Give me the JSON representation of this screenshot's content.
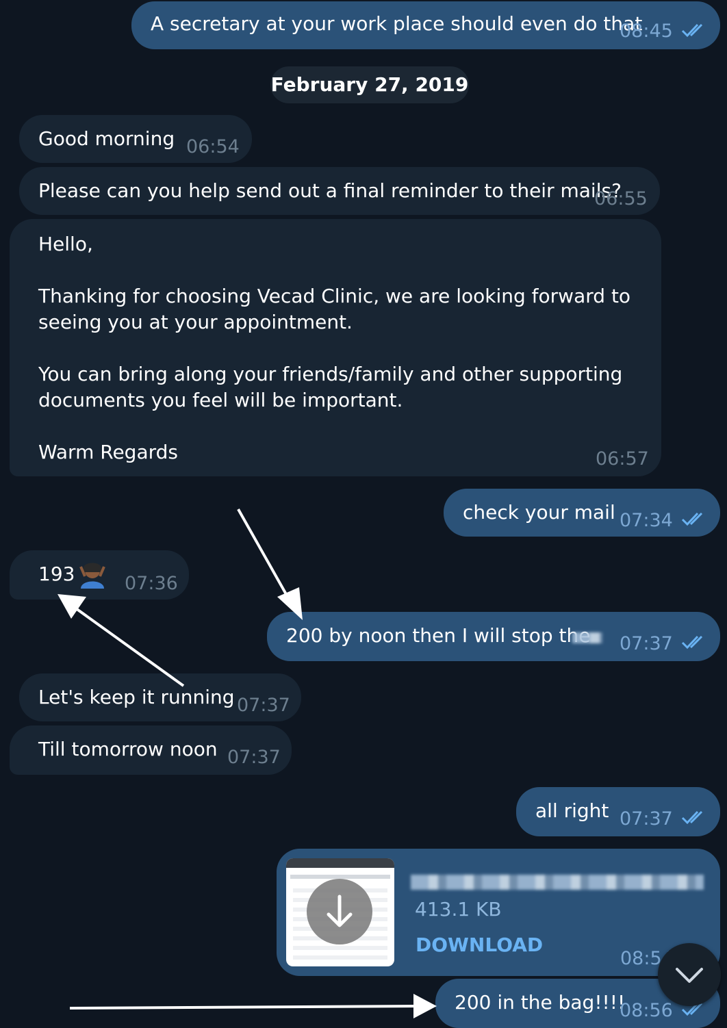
{
  "date_separator": "February 27, 2019",
  "messages": [
    {
      "text": "A secretary at your work place should even do that",
      "time": "08:45"
    },
    {
      "text": "Good morning",
      "time": "06:54"
    },
    {
      "text": "Please can you help send out a final reminder to their mails?",
      "time": "06:55"
    },
    {
      "lines": [
        "Hello,",
        "Thanking for choosing Vecad Clinic, we are looking forward to",
        "seeing you at your appointment.",
        "You can bring along your friends/family and other supporting",
        "documents you feel will be important.",
        "Warm Regards"
      ],
      "time": "06:57"
    },
    {
      "text": "check your mail",
      "time": "07:34"
    },
    {
      "text": "193",
      "time": "07:36"
    },
    {
      "text": "200 by noon then I will stop the",
      "time": "07:37"
    },
    {
      "text": "Let's keep it running",
      "time": "07:37"
    },
    {
      "text": "Till tomorrow noon",
      "time": "07:37"
    },
    {
      "text": "all right",
      "time": "07:37"
    },
    {
      "file_size": "413.1 KB",
      "download_label": "DOWNLOAD",
      "time": "08:54"
    },
    {
      "text": "200 in the bag!!!!",
      "time": "08:56"
    }
  ],
  "colors": {
    "background": "#0e1621",
    "incoming_bubble": "#182533",
    "outgoing_bubble": "#2b5278",
    "accent": "#6ab3f3",
    "annotation_arrow": "#ffffff"
  },
  "icons": [
    "double-check-icon",
    "download-arrow-icon",
    "scroll-down-chevron-icon",
    "person-emoji-icon"
  ]
}
